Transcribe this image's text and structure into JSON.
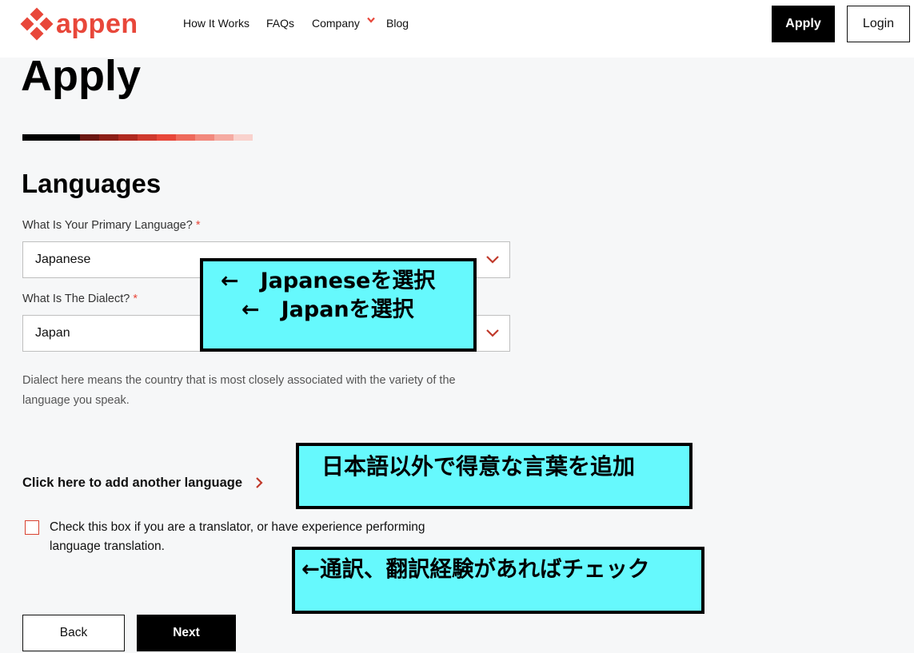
{
  "header": {
    "logo_text": "appen",
    "nav": [
      "How It Works",
      "FAQs",
      "Company",
      "Blog"
    ],
    "apply_label": "Apply",
    "login_label": "Login"
  },
  "page": {
    "title": "Apply",
    "progress_colors": [
      "#000000",
      "#6b1712",
      "#8d1f17",
      "#b02a20",
      "#cf3a2e",
      "#e8473a",
      "#ee6a5c",
      "#f2897d",
      "#f5aba2",
      "#f9d2cd"
    ],
    "section_title": "Languages",
    "primary_language": {
      "label": "What Is Your Primary Language?",
      "required_mark": "*",
      "value": "Japanese"
    },
    "dialect": {
      "label": "What Is The Dialect?",
      "required_mark": "*",
      "value": "Japan"
    },
    "helper_text": "Dialect here means the country that is most closely associated with the variety of the language you speak.",
    "add_language_label": "Click here to add another language",
    "translator_checkbox": {
      "checked": false,
      "label": "Check this box if you are a translator, or have experience performing language translation."
    },
    "back_label": "Back",
    "next_label": "Next"
  },
  "annotations": {
    "note1_line1": "←　Japaneseを選択",
    "note1_line2": "←　Japanを選択",
    "note2": "日本語以外で得意な言葉を追加",
    "note3": "←通訳、翻訳経験があればチェック"
  },
  "colors": {
    "accent": "#e8473a",
    "note_background": "#66f9fd"
  }
}
